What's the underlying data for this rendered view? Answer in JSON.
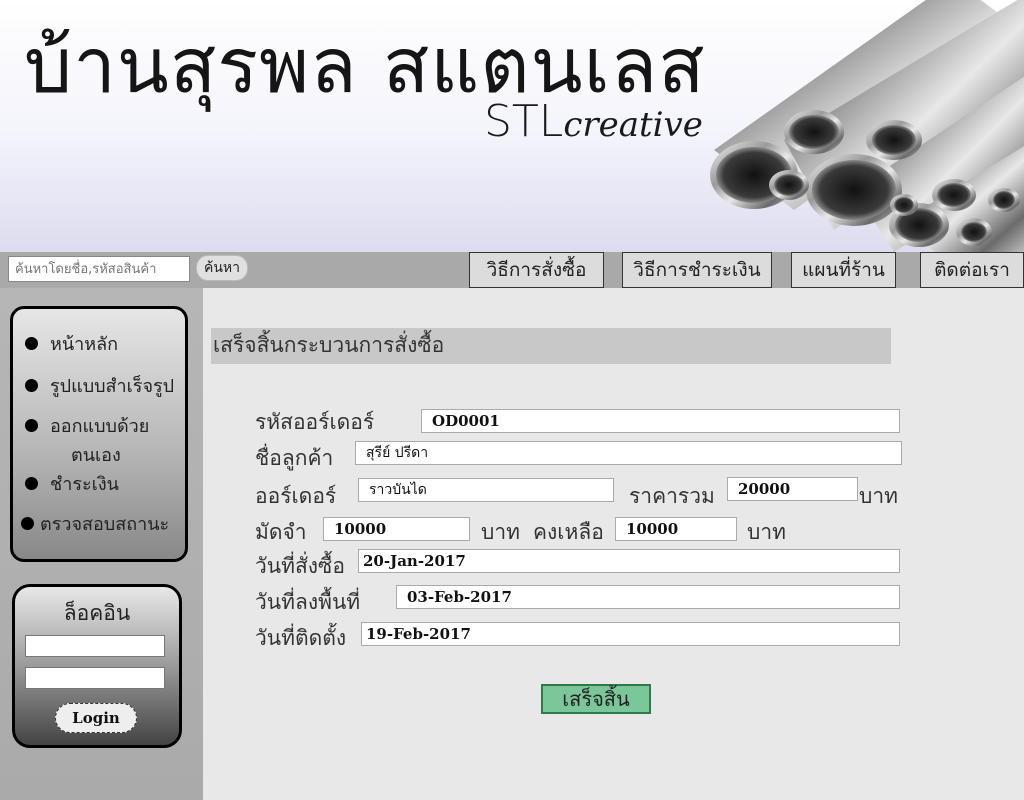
{
  "header": {
    "brand_title": "บ้านสุรพล สแตนเลส",
    "brand_sub_1": "STL",
    "brand_sub_2": "creative"
  },
  "navbar": {
    "search_placeholder": "ค้นหาโดยชื่อ,รหัสอสินค้า",
    "search_button": "ค้นหา",
    "tabs": [
      "วิธีการสั่งซื้อ",
      "วิธีการชำระเงิน",
      "แผนที่ร้าน",
      "ติดต่อเรา"
    ]
  },
  "sidebar": {
    "menu": [
      {
        "label": "หน้าหลัก"
      },
      {
        "label": "รูปแบบสำเร็จรูป"
      },
      {
        "label": "ออกแบบด้วย",
        "label2": "ตนเอง"
      },
      {
        "label": "ชำระเงิน"
      },
      {
        "label": "ตรวจสอบสถานะ"
      }
    ],
    "login": {
      "title": "ล็อคอิน",
      "button": "Login"
    }
  },
  "form": {
    "title": "เสร็จสิ้นกระบวนการสั่งซื้อ",
    "order_code_label": "รหัสออร์เดอร์",
    "order_code": "OD0001",
    "customer_label": "ชื่อลูกค้า",
    "customer": "สุรีย์ ปรีดา",
    "order_label": "ออร์เดอร์",
    "order": "ราวบันได",
    "price_label": "ราคารวม",
    "price": "20000",
    "baht_1": "บาท",
    "deposit_label": "มัดจำ",
    "deposit": "10000",
    "baht_2": "บาท",
    "remaining_label": "คงเหลือ",
    "remaining": "10000",
    "baht_3": "บาท",
    "order_date_label": "วันที่สั่งซื้อ",
    "order_date": "20-Jan-2017",
    "survey_date_label": "วันที่ลงพื้นที่",
    "survey_date": "03-Feb-2017",
    "install_date_label": "วันที่ติดตั้ง",
    "install_date": "19-Feb-2017",
    "done_button": "เสร็จสิ้น"
  }
}
